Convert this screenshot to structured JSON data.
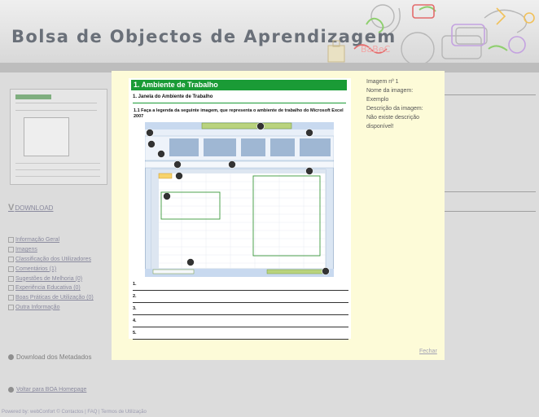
{
  "header": {
    "title": "Bolsa de Objectos de Aprendizagem"
  },
  "sidebar": {
    "download_label": "DOWNLOAD",
    "items": [
      {
        "label": "Informação Geral"
      },
      {
        "label": "Imagens"
      },
      {
        "label": "Classificação dos Utilizadores"
      },
      {
        "label": "Comentários (1)"
      },
      {
        "label": "Sugestões de Melhoria (0)"
      },
      {
        "label": "Experiência Educativa (0)"
      },
      {
        "label": "Boas Práticas de Utilização (0)"
      },
      {
        "label": "Outra Informação"
      }
    ],
    "metadata_download": "Download dos Metadados",
    "home_link": "Voltar para BOA Homepage"
  },
  "footer": {
    "text": "Powered by: webConfort © Contactos | FAQ | Termos de Utilização"
  },
  "lightbox": {
    "document": {
      "banner": "1. Ambiente de Trabalho",
      "subtitle": "1. Janela do Ambiente de Trabalho",
      "question": "1.1 Faça a legenda da seguinte imagem, que representa o ambiente de trabalho do Microsoft Excel 2007",
      "answers": [
        "1.",
        "2.",
        "3.",
        "4.",
        "5."
      ]
    },
    "info": {
      "image_number": "Imagem nº 1",
      "name_label": "Nome da imagem:",
      "name_value": "Exemplo",
      "desc_label": "Descrição da imagem:",
      "desc_value": "Não existe descrição disponível!"
    },
    "close_label": "Fechar"
  },
  "colors": {
    "banner_green": "#1a9b36",
    "lightbox_bg": "#fdfbd8",
    "link": "#8a8a9e"
  }
}
